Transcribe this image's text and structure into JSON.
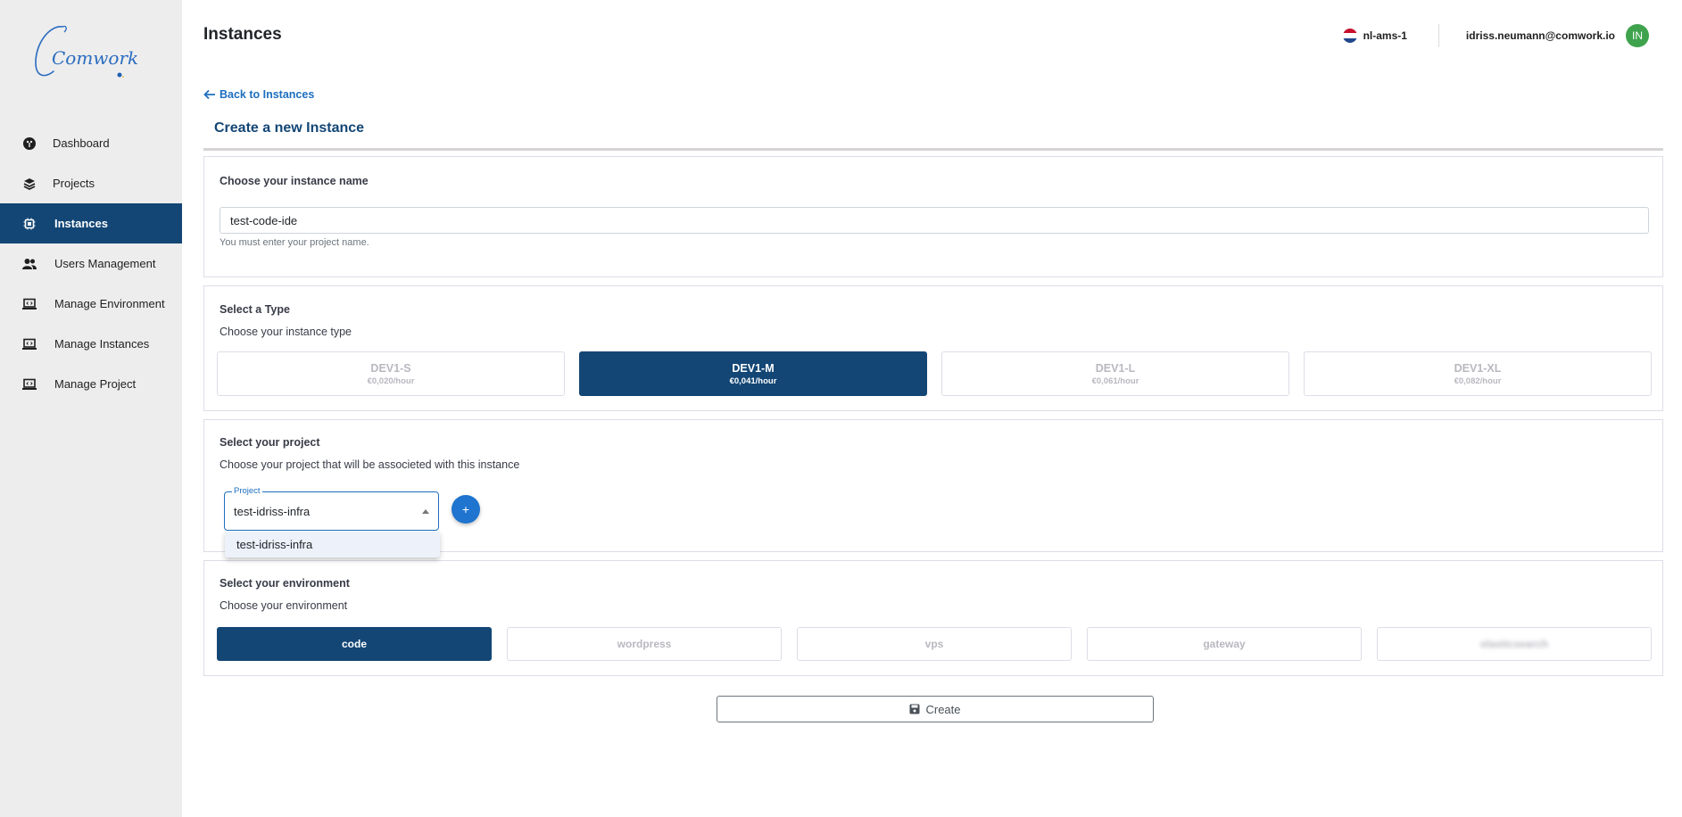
{
  "brand": {
    "logo_text": "Comwork",
    "accent": "#134675",
    "link": "#1d6fbf"
  },
  "sidebar": {
    "items": [
      {
        "label": "Dashboard",
        "icon": "dashboard-icon",
        "active": false
      },
      {
        "label": "Projects",
        "icon": "layers-icon",
        "active": false
      },
      {
        "label": "Instances",
        "icon": "chip-icon",
        "active": true
      },
      {
        "label": "Users Management",
        "icon": "users-icon",
        "active": false
      },
      {
        "label": "Manage Environment",
        "icon": "laptop-code-icon",
        "active": false
      },
      {
        "label": "Manage Instances",
        "icon": "laptop-code-icon",
        "active": false
      },
      {
        "label": "Manage Project",
        "icon": "laptop-code-icon",
        "active": false
      }
    ]
  },
  "header": {
    "title": "Instances",
    "region": "nl-ams-1",
    "user_email": "idriss.neumann@comwork.io",
    "avatar_initials": "IN"
  },
  "page": {
    "back_link": "Back to Instances",
    "section_title": "Create a new Instance"
  },
  "name_card": {
    "label": "Choose your instance name",
    "input_value": "test-code-ide",
    "help_text": "You must enter your project name."
  },
  "type_card": {
    "label": "Select a Type",
    "subtitle": "Choose your instance type",
    "options": [
      {
        "name": "DEV1-S",
        "price": "€0,020/hour",
        "selected": false
      },
      {
        "name": "DEV1-M",
        "price": "€0,041/hour",
        "selected": true
      },
      {
        "name": "DEV1-L",
        "price": "€0,061/hour",
        "selected": false
      },
      {
        "name": "DEV1-XL",
        "price": "€0,082/hour",
        "selected": false
      }
    ]
  },
  "project_card": {
    "label": "Select your project",
    "subtitle": "Choose your project that will be associeted with this instance",
    "select_legend": "Project",
    "select_value": "test-idriss-infra",
    "add_button": "+",
    "dropdown_options": [
      "test-idriss-infra"
    ]
  },
  "env_card": {
    "label": "Select your environment",
    "subtitle": "Choose your environment",
    "options": [
      {
        "name": "code",
        "selected": true
      },
      {
        "name": "wordpress",
        "selected": false
      },
      {
        "name": "vps",
        "selected": false
      },
      {
        "name": "gateway",
        "selected": false
      },
      {
        "name": "elasticsearch",
        "selected": false,
        "blurred": true
      }
    ]
  },
  "actions": {
    "create_label": "Create"
  }
}
